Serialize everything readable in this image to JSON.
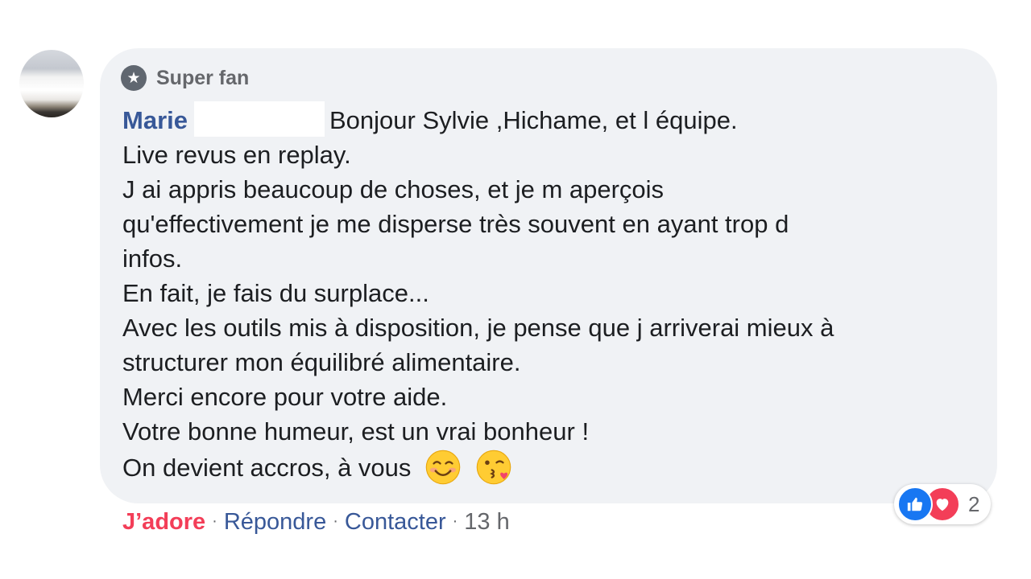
{
  "comment": {
    "badge": {
      "icon": "star-icon",
      "label": "Super fan"
    },
    "author": "Marie",
    "lines": [
      "Bonjour Sylvie ,Hichame, et l équipe.",
      "Live revus en replay.",
      "J ai appris beaucoup de choses, et je m aperçois",
      "qu'effectivement je me disperse très souvent en ayant trop d",
      "infos.",
      "En fait, je fais du surplace...",
      "Avec les outils mis à disposition, je pense que j arriverai mieux à",
      "structurer mon équilibré alimentaire.",
      "Merci encore pour votre aide.",
      "Votre bonne humeur, est un vrai bonheur !",
      "On devient accros, à vous"
    ],
    "emojis": [
      "smiling-face-emoji",
      "kissing-face-emoji"
    ]
  },
  "actions": {
    "love_label": "J’adore",
    "separator": "·",
    "reply_label": "Répondre",
    "contact_label": "Contacter",
    "timestamp": "13 h"
  },
  "reactions": {
    "icons": [
      "like-icon",
      "love-icon"
    ],
    "count": "2"
  },
  "colors": {
    "bubble": "#f0f2f5",
    "author": "#385898",
    "love": "#f33e58",
    "like": "#1877f2",
    "muted": "#65676b",
    "text": "#1c1e21"
  }
}
